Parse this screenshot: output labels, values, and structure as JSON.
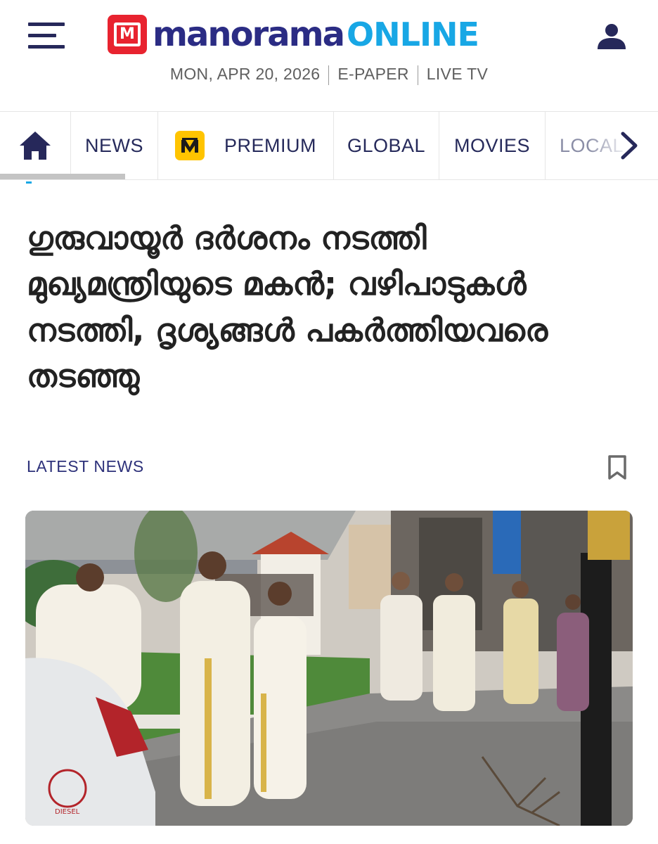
{
  "header": {
    "logo_mark": "M",
    "logo_word": "manorama",
    "logo_online": "ONLINE",
    "date": "MON, APR 20, 2026",
    "epaper": "E-PAPER",
    "livetv": "LIVE TV",
    "icons": {
      "menu": "hamburger-menu-icon",
      "user": "user-account-icon"
    }
  },
  "nav": {
    "home_icon": "home-icon",
    "items": [
      "NEWS",
      "PREMIUM",
      "GLOBAL",
      "MOVIES",
      "LOCAL"
    ],
    "premium_badge": "M",
    "next_icon": "chevron-right-icon"
  },
  "article": {
    "headline": "ഗുരുവായൂർ ദർശനം നടത്തി മുഖ്യമന്ത്രിയുടെ മകൻ; വഴിപാടുകൾ നടത്തി, ദൃശ്യങ്ങൾ പകർത്തിയവരെ തടഞ്ഞു",
    "category": "LATEST NEWS",
    "bookmark_icon": "bookmark-icon",
    "photo_text": "DIESEL"
  },
  "colors": {
    "brand_red": "#e8232f",
    "brand_navy": "#2b2c84",
    "brand_blue": "#18a7e5",
    "premium_yellow": "#ffc400"
  }
}
